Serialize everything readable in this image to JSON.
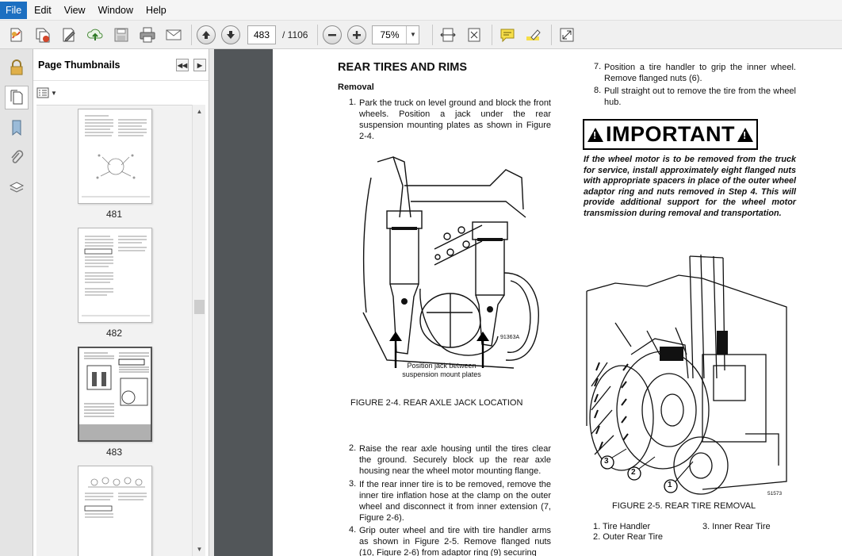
{
  "menu": {
    "items": [
      "File",
      "Edit",
      "View",
      "Window",
      "Help"
    ]
  },
  "toolbar": {
    "page_current": "483",
    "page_total": "/ 1106",
    "zoom": "75%",
    "icons": [
      "create-pdf-icon",
      "combine-icon",
      "edit-icon",
      "upload-icon",
      "save-icon",
      "print-icon",
      "email-icon",
      "prev-page-icon",
      "next-page-icon",
      "zoom-out-icon",
      "zoom-in-icon",
      "fit-width-icon",
      "fit-page-icon",
      "comment-icon",
      "highlight-icon",
      "fullscreen-icon"
    ]
  },
  "panel": {
    "title": "Page Thumbnails",
    "thumbnails": [
      {
        "label": "481"
      },
      {
        "label": "482"
      },
      {
        "label": "483"
      },
      {
        "label": ""
      }
    ]
  },
  "document": {
    "left": {
      "title": "REAR TIRES AND RIMS",
      "subtitle": "Removal",
      "step1_num": "1.",
      "step1": "Park the truck on level ground and block the front wheels. Position a jack under the rear suspension mounting plates as shown in Figure 2-4.",
      "fig4_code": "91363A",
      "fig4_note": "Position jack between suspension mount plates",
      "fig4_caption": "FIGURE 2-4. REAR AXLE JACK LOCATION",
      "step2_num": "2.",
      "step2": "Raise the rear axle housing until the tires clear the ground. Securely block up the rear axle housing near the wheel motor mounting flange.",
      "step3_num": "3.",
      "step3": "If the rear inner tire is to be removed, remove the inner tire inflation hose at the clamp on the outer wheel and disconnect it from inner extension (7, Figure 2-6).",
      "step4_num": "4.",
      "step4": "Grip outer wheel and tire with tire handler arms as shown in Figure 2-5. Remove flanged nuts (10, Figure 2-6) from adaptor ring (9) securing"
    },
    "right": {
      "step7_num": "7.",
      "step7": "Position a tire handler to grip the inner wheel. Remove flanged nuts (6).",
      "step8_num": "8.",
      "step8": "Pull straight out to remove the tire from the wheel hub.",
      "important_label": "IMPORTANT",
      "important_text": "If the wheel motor is to be removed from the truck for service, install approximately eight flanged nuts with appropriate spacers in place of the outer wheel adaptor ring and nuts removed in Step 4. This will provide additional support for the wheel motor transmission during removal and transportation.",
      "fig5_code": "51573",
      "callout1": "1",
      "callout2": "2",
      "callout3": "3",
      "fig5_caption": "FIGURE 2-5. REAR TIRE REMOVAL",
      "legend1": "1. Tire Handler",
      "legend2": "2. Outer Rear Tire",
      "legend3": "3. Inner Rear Tire"
    }
  }
}
